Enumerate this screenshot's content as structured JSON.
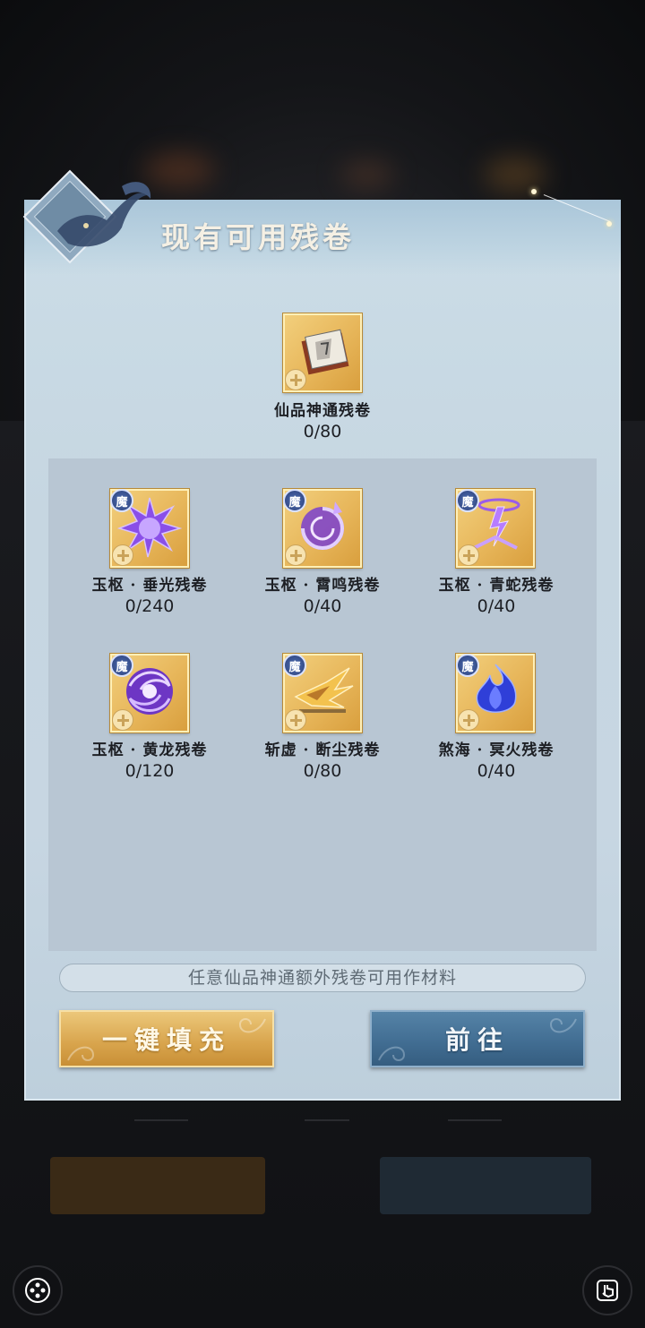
{
  "dialog": {
    "title": "现有可用残卷",
    "featured": {
      "name": "仙品神通残卷",
      "count": "0/80"
    },
    "items": [
      {
        "name": "玉枢 · 垂光残卷",
        "count": "0/240",
        "badge": "魔",
        "icon": "purple-burst-scroll-icon",
        "color": "#9b5cff"
      },
      {
        "name": "玉枢 · 霄鸣残卷",
        "count": "0/40",
        "badge": "魔",
        "icon": "purple-vortex-scroll-icon",
        "color": "#a45be8"
      },
      {
        "name": "玉枢 · 青蛇残卷",
        "count": "0/40",
        "badge": "魔",
        "icon": "purple-lightning-scroll-icon",
        "color": "#b06cf0"
      },
      {
        "name": "玉枢 · 黄龙残卷",
        "count": "0/120",
        "badge": "魔",
        "icon": "purple-swirl-scroll-icon",
        "color": "#9a58e6"
      },
      {
        "name": "斩虚 · 断尘残卷",
        "count": "0/80",
        "badge": "魔",
        "icon": "golden-blades-scroll-icon",
        "color": "#e0a23a"
      },
      {
        "name": "煞海 · 冥火残卷",
        "count": "0/40",
        "badge": "魔",
        "icon": "blue-flame-scroll-icon",
        "color": "#3a4fe0"
      }
    ],
    "hint": "任意仙品神通额外残卷可用作材料",
    "buttons": {
      "fill": "一键填充",
      "go": "前往"
    }
  }
}
